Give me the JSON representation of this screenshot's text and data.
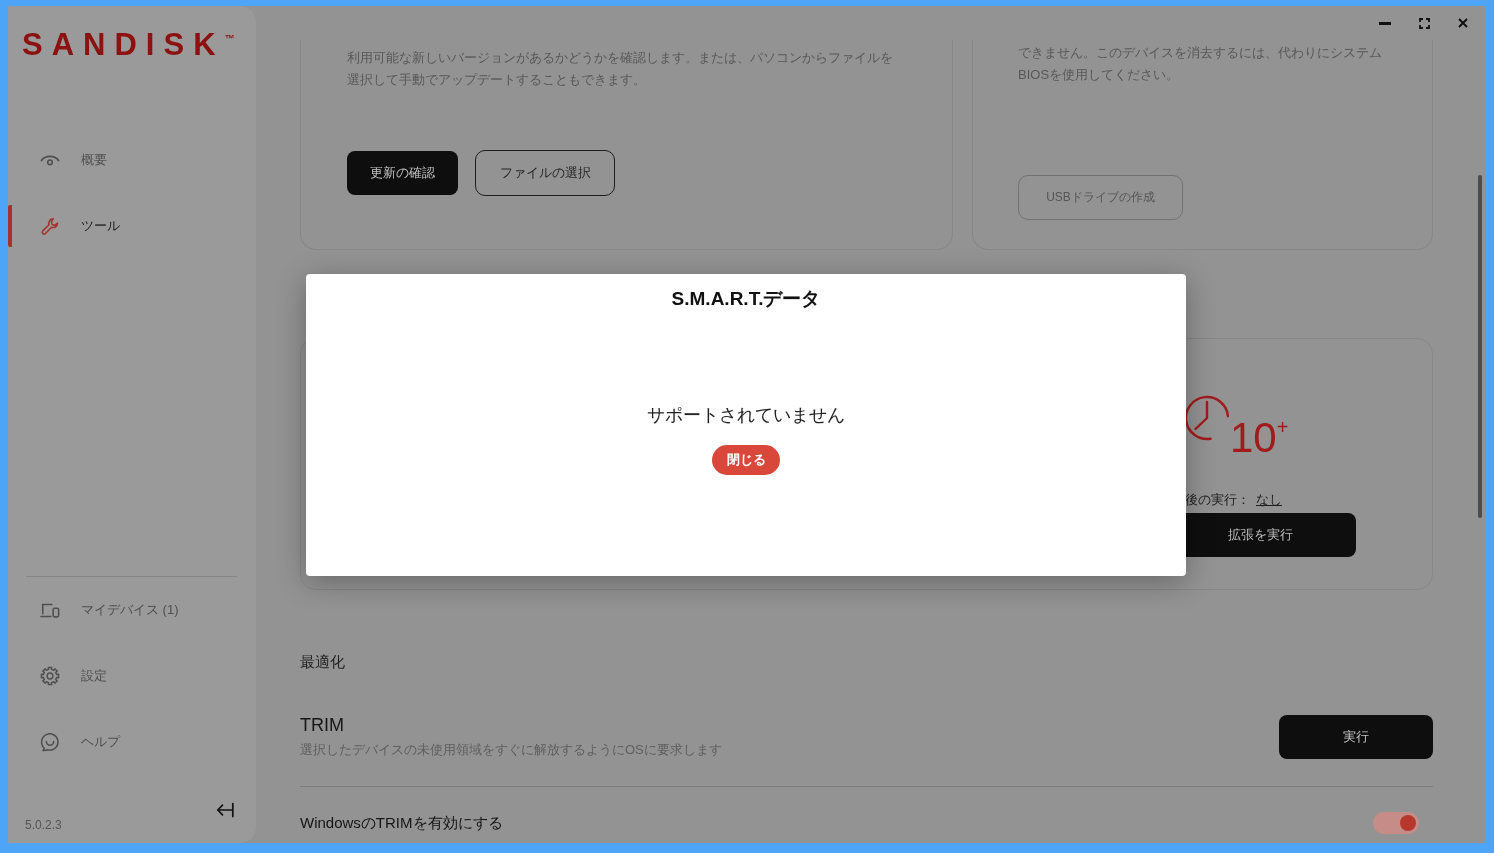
{
  "sidebar": {
    "logo": "SANDISK",
    "logo_mark": "™",
    "nav_items": [
      {
        "label": "概要",
        "selected": false
      },
      {
        "label": "ツール",
        "selected": true
      }
    ],
    "bottom_items": [
      {
        "label": "マイデバイス (1)",
        "selected": false
      },
      {
        "label": "設定",
        "selected": false
      },
      {
        "label": "ヘルプ",
        "selected": false
      }
    ],
    "version": "5.0.2.3"
  },
  "update_card": {
    "description": "利用可能な新しいバージョンがあるかどうかを確認します。または、パソコンからファイルを選択して手動でアップデートすることもできます。",
    "buttons": [
      {
        "label": "更新の確認",
        "kind": "primary"
      },
      {
        "label": "ファイルの選択",
        "kind": "outline"
      }
    ]
  },
  "bootable_card": {
    "description": "できません。このデバイスを消去するには、代わりにシステムBIOSを使用してください。",
    "button": {
      "label": "USBドライブの作成",
      "disabled": true
    }
  },
  "expand_card": {
    "count": "10$^{+}$",
    "last_run_label": "後の実行：",
    "last_run_value": "なし",
    "button": "拡張を実行"
  },
  "optimization": {
    "heading": "最適化",
    "rows": [
      {
        "kind": "button",
        "title": "TRIM",
        "description": "選択したデバイスの未使用領域をすぐに解放するようにOSに要求します",
        "button": "実行"
      },
      {
        "kind": "toggle",
        "title": "WindowsのTRIMを有効にする",
        "on": true
      }
    ]
  },
  "dialog": {
    "title": "S.M.A.R.T.データ",
    "message": "サポートされていません",
    "button": "閉じる"
  }
}
